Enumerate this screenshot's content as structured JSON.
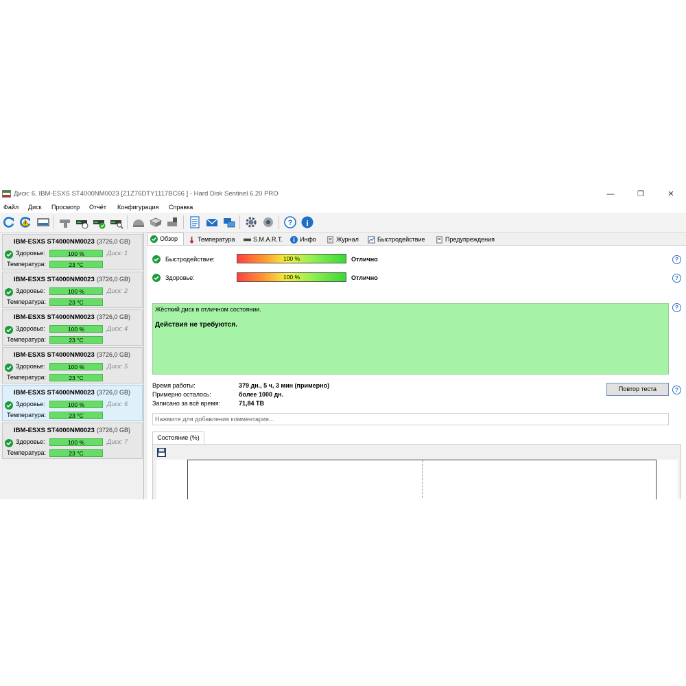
{
  "window": {
    "title": "Диск: 6, IBM-ESXS ST4000NM0023 [Z1Z76DTY1117BC66   ]  -  Hard Disk Sentinel 6.20 PRO",
    "controls": {
      "minimize": "—",
      "maximize": "❐",
      "close": "✕"
    }
  },
  "menu": [
    "Файл",
    "Диск",
    "Просмотр",
    "Отчёт",
    "Конфигурация",
    "Справка"
  ],
  "toolbar_icons": [
    "refresh-icon",
    "refresh-warning-icon",
    "disk-icon",
    "disk-test-icon",
    "disk-timer-icon",
    "disk-check-icon",
    "disk-search-icon",
    "disk-surface-icon",
    "disk-tools-icon",
    "disk-settings-icon",
    "report-icon",
    "email-icon",
    "network-icon",
    "gear-icon",
    "sound-icon",
    "help-icon",
    "info-icon"
  ],
  "disk_list": {
    "health_label": "Здоровье:",
    "temp_label": "Температура:",
    "items": [
      {
        "name": "IBM-ESXS ST4000NM0023",
        "size": "(3726,0 GB)",
        "health": "100 %",
        "health_level": 100,
        "disk": "Диск: 1",
        "temp": "23 °C"
      },
      {
        "name": "IBM-ESXS ST4000NM0023",
        "size": "(3726,0 GB)",
        "health": "100 %",
        "health_level": 100,
        "disk": "Диск: 2",
        "temp": "23 °C"
      },
      {
        "name": "IBM-ESXS ST4000NM0023",
        "size": "(3726,0 GB)",
        "health": "100 %",
        "health_level": 100,
        "disk": "Диск: 4",
        "temp": "23 °C"
      },
      {
        "name": "IBM-ESXS ST4000NM0023",
        "size": "(3726,0 GB)",
        "health": "100 %",
        "health_level": 100,
        "disk": "Диск: 5",
        "temp": "23 °C"
      },
      {
        "name": "IBM-ESXS ST4000NM0023",
        "size": "(3726,0 GB)",
        "health": "100 %",
        "health_level": 100,
        "disk": "Диск: 6",
        "temp": "23 °C"
      },
      {
        "name": "IBM-ESXS ST4000NM0023",
        "size": "(3726,0 GB)",
        "health": "100 %",
        "health_level": 100,
        "disk": "Диск: 7",
        "temp": "23 °C"
      }
    ]
  },
  "tabs": [
    "Обзор",
    "Температура",
    "S.M.A.R.T.",
    "Инфо",
    "Журнал",
    "Быстродействие",
    "Предупреждения"
  ],
  "overview": {
    "performance_label": "Быстродействие:",
    "performance_value": "100 %",
    "performance_level": 100,
    "performance_status": "Отлично",
    "health_label": "Здоровье:",
    "health_value": "100 %",
    "health_level": 100,
    "health_status": "Отлично",
    "message_line1": "Жёсткий диск в отличном состоянии.",
    "message_line2": "Действия не требуются.",
    "uptime_label": "Время работы:",
    "uptime_value": "379 дн., 5 ч, 3 мин (примерно)",
    "remaining_label": "Примерно осталось:",
    "remaining_value": "более 1000 дн.",
    "written_label": "Записано за всё время:",
    "written_value": "71,84 TB",
    "retest_button": "Повтор теста",
    "comment_placeholder": "Нажмите для добавления комментария...",
    "state_tab": "Состояние (%)"
  },
  "colors": {
    "ok_green": "#1a9a3a",
    "bar_green": "#66dd66",
    "message_bg": "#a6f2a6",
    "help_blue": "#2e6fc0"
  }
}
